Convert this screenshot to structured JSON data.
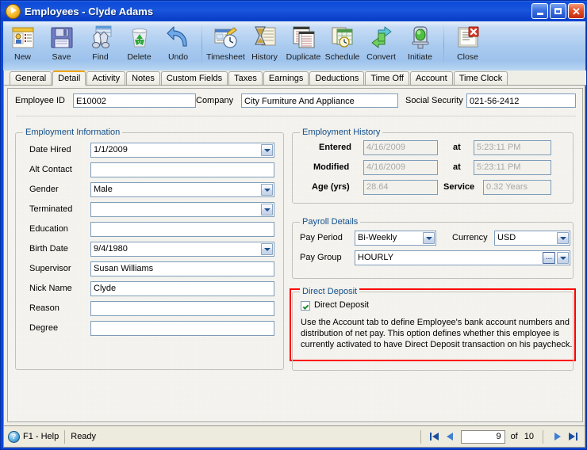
{
  "window": {
    "title": "Employees - Clyde Adams",
    "app_icon": "employees-app-icon",
    "buttons": {
      "minimize": "_",
      "maximize": "□",
      "close": "✕"
    }
  },
  "toolbar": {
    "items": [
      {
        "label": "New",
        "icon": "new-record-icon"
      },
      {
        "label": "Save",
        "icon": "floppy-disk-save-icon"
      },
      {
        "label": "Find",
        "icon": "binoculars-find-icon"
      },
      {
        "label": "Delete",
        "icon": "trash-recycle-delete-icon"
      },
      {
        "label": "Undo",
        "icon": "undo-arrow-icon"
      },
      {
        "label": "Timesheet",
        "icon": "timesheet-clock-icon"
      },
      {
        "label": "History",
        "icon": "hourglass-history-icon"
      },
      {
        "label": "Duplicate",
        "icon": "duplicate-pages-icon"
      },
      {
        "label": "Schedule",
        "icon": "schedule-calendar-icon"
      },
      {
        "label": "Convert",
        "icon": "convert-arrows-icon"
      },
      {
        "label": "Initiate",
        "icon": "initiate-traffic-light-icon"
      },
      {
        "label": "Close",
        "icon": "close-document-icon"
      }
    ]
  },
  "tabs": [
    {
      "label": "General",
      "active": false
    },
    {
      "label": "Detail",
      "active": true
    },
    {
      "label": "Activity",
      "active": false
    },
    {
      "label": "Notes",
      "active": false
    },
    {
      "label": "Custom Fields",
      "active": false
    },
    {
      "label": "Taxes",
      "active": false
    },
    {
      "label": "Earnings",
      "active": false
    },
    {
      "label": "Deductions",
      "active": false
    },
    {
      "label": "Time Off",
      "active": false
    },
    {
      "label": "Account",
      "active": false
    },
    {
      "label": "Time Clock",
      "active": false
    }
  ],
  "header": {
    "employee_id_label": "Employee ID",
    "employee_id_value": "E10002",
    "company_label": "Company",
    "company_value": "City Furniture And Appliance",
    "ssn_label": "Social Security",
    "ssn_value": "021-56-2412"
  },
  "employment_information": {
    "title": "Employment Information",
    "fields": [
      {
        "label": "Date Hired",
        "value": "1/1/2009",
        "type": "combo"
      },
      {
        "label": "Alt Contact",
        "value": "",
        "type": "text"
      },
      {
        "label": "Gender",
        "value": "Male",
        "type": "combo"
      },
      {
        "label": "Terminated",
        "value": "",
        "type": "combo"
      },
      {
        "label": "Education",
        "value": "",
        "type": "text"
      },
      {
        "label": "Birth Date",
        "value": "9/4/1980",
        "type": "combo"
      },
      {
        "label": "Supervisor",
        "value": "Susan Williams",
        "type": "text"
      },
      {
        "label": "Nick Name",
        "value": "Clyde",
        "type": "text"
      },
      {
        "label": "Reason",
        "value": "",
        "type": "text"
      },
      {
        "label": "Degree",
        "value": "",
        "type": "text"
      }
    ]
  },
  "employment_history": {
    "title": "Employment History",
    "entered_label": "Entered",
    "entered_value": "4/16/2009",
    "entered_at_label": "at",
    "entered_at_value": "5:23:11 PM",
    "modified_label": "Modified",
    "modified_value": "4/16/2009",
    "modified_at_label": "at",
    "modified_at_value": "5:23:11 PM",
    "age_label": "Age (yrs)",
    "age_value": "28.64",
    "service_label": "Service",
    "service_value": "0.32 Years"
  },
  "payroll_details": {
    "title": "Payroll Details",
    "pay_period_label": "Pay Period",
    "pay_period_value": "Bi-Weekly",
    "currency_label": "Currency",
    "currency_value": "USD",
    "pay_group_label": "Pay Group",
    "pay_group_value": "HOURLY",
    "ellipsis_label": "..."
  },
  "direct_deposit": {
    "title": "Direct Deposit",
    "checkbox_label": "Direct Deposit",
    "checked": true,
    "note_line1": "Use the Account tab to define Employee's bank account numbers and",
    "note_line2": "distribution of net pay. This option defines whether this employee is",
    "note_line3": "currently activated to have Direct Deposit transaction on his paycheck.",
    "highlight_color": "#ff0000"
  },
  "statusbar": {
    "help_icon": "help-question-icon",
    "help_label": "F1 - Help",
    "status_text": "Ready",
    "first_icon": "first-record-icon",
    "prev_icon": "previous-record-icon",
    "record_number": "9",
    "of_label": "of",
    "record_total": "10",
    "next_icon": "next-record-icon",
    "last_icon": "last-record-icon"
  },
  "colors": {
    "titlebar": "#0b4ad9",
    "tab_active_accent": "#f0a30a",
    "group_title": "#14508c",
    "highlight": "#ff0000",
    "client_bg": "#f2f1ec"
  }
}
